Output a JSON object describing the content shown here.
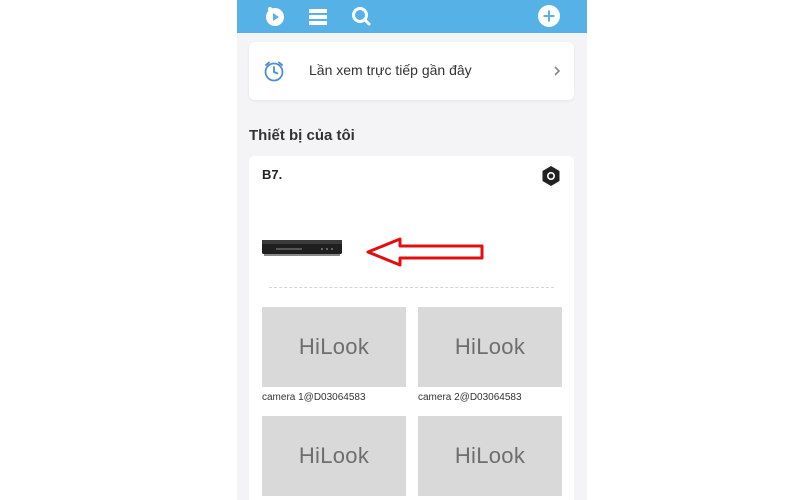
{
  "topbar": {
    "icons": [
      "playback-icon",
      "list-icon",
      "search-icon",
      "add-icon"
    ],
    "background": "#56b1e6"
  },
  "recent": {
    "label": "Lần xem trực tiếp gần đây",
    "icon": "stopwatch-icon",
    "accent": "#4a8ed8"
  },
  "section": {
    "title": "Thiết bị của tôi"
  },
  "device": {
    "name": "B7.",
    "annotation": "red-arrow",
    "cameras": [
      {
        "logo": "HiLook",
        "label": "camera 1@D03064583"
      },
      {
        "logo": "HiLook",
        "label": "camera 2@D03064583"
      },
      {
        "logo": "HiLook",
        "label": ""
      },
      {
        "logo": "HiLook",
        "label": ""
      }
    ]
  }
}
